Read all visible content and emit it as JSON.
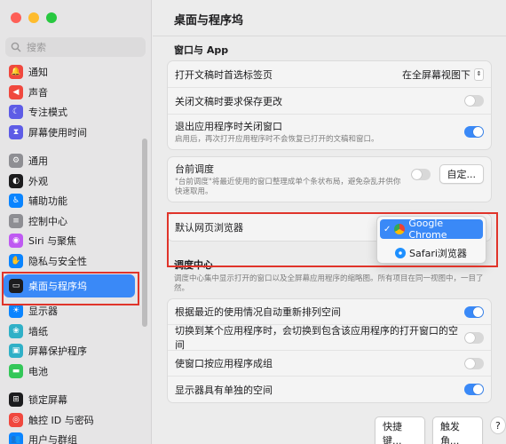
{
  "window": {
    "title": "桌面与程序坞"
  },
  "search": {
    "placeholder": "搜索"
  },
  "sidebar": {
    "items": [
      {
        "label": "通知",
        "icon": "bell-icon",
        "color": "#f0483e",
        "glyph": "🔔"
      },
      {
        "label": "声音",
        "icon": "speaker-icon",
        "color": "#f0483e",
        "glyph": "◀"
      },
      {
        "label": "专注模式",
        "icon": "moon-icon",
        "color": "#5e5ce6",
        "glyph": "☾"
      },
      {
        "label": "屏幕使用时间",
        "icon": "hourglass-icon",
        "color": "#5e5ce6",
        "glyph": "⧗"
      },
      {
        "label": "通用",
        "icon": "gear-icon",
        "color": "#8e8e93",
        "glyph": "⚙"
      },
      {
        "label": "外观",
        "icon": "appearance-icon",
        "color": "#1c1c1e",
        "glyph": "◐"
      },
      {
        "label": "辅助功能",
        "icon": "accessibility-icon",
        "color": "#0a84ff",
        "glyph": "♿"
      },
      {
        "label": "控制中心",
        "icon": "control-center-icon",
        "color": "#8e8e93",
        "glyph": "≡"
      },
      {
        "label": "Siri 与聚焦",
        "icon": "siri-icon",
        "color": "#bf5af2",
        "glyph": "◉"
      },
      {
        "label": "隐私与安全性",
        "icon": "hand-icon",
        "color": "#0a84ff",
        "glyph": "✋"
      },
      {
        "label": "桌面与程序坞",
        "icon": "dock-icon",
        "color": "#1c1c1e",
        "glyph": "▭"
      },
      {
        "label": "显示器",
        "icon": "display-icon",
        "color": "#0a84ff",
        "glyph": "☀"
      },
      {
        "label": "墙纸",
        "icon": "wallpaper-icon",
        "color": "#30b0c7",
        "glyph": "❀"
      },
      {
        "label": "屏幕保护程序",
        "icon": "screensaver-icon",
        "color": "#30b0c7",
        "glyph": "▣"
      },
      {
        "label": "电池",
        "icon": "battery-icon",
        "color": "#34c759",
        "glyph": "▬"
      },
      {
        "label": "锁定屏幕",
        "icon": "lock-icon",
        "color": "#1c1c1e",
        "glyph": "⊞"
      },
      {
        "label": "触控 ID 与密码",
        "icon": "fingerprint-icon",
        "color": "#f0483e",
        "glyph": "◎"
      },
      {
        "label": "用户与群组",
        "icon": "users-icon",
        "color": "#0a84ff",
        "glyph": "👥"
      }
    ]
  },
  "main": {
    "section_windows": "窗口与 App",
    "prefer_tabs": {
      "label": "打开文稿时首选标签页",
      "value": "在全屏幕视图下"
    },
    "ask_save": {
      "label": "关闭文稿时要求保存更改",
      "on": false
    },
    "close_windows": {
      "label": "退出应用程序时关闭窗口",
      "sub": "启用后，再次打开应用程序时不会恢复已打开的文稿和窗口。",
      "on": true
    },
    "stage_manager": {
      "label": "台前调度",
      "sub": "\"台前调度\"将最近使用的窗口整理成单个条状布局，避免杂乱并供你快速取用。",
      "on": false,
      "button": "自定..."
    },
    "default_browser": {
      "label": "默认网页浏览器",
      "options": [
        {
          "label": "Google Chrome",
          "selected": true
        },
        {
          "label": "Safari浏览器",
          "selected": false
        }
      ]
    },
    "mission_control": {
      "heading": "调度中心",
      "sub": "调度中心集中显示打开的窗口以及全屏幕应用程序的缩略图。所有项目在同一视图中，一目了然。"
    },
    "auto_rearrange": {
      "label": "根据最近的使用情况自动重新排列空间",
      "on": true
    },
    "switch_space": {
      "label": "切换到某个应用程序时，会切换到包含该应用程序的打开窗口的空间",
      "on": false
    },
    "group_windows": {
      "label": "使窗口按应用程序成组",
      "on": false
    },
    "separate_spaces": {
      "label": "显示器具有单独的空间",
      "on": true
    },
    "shortcuts_button": "快捷键...",
    "hot_corners_button": "触发角...",
    "help_button": "?"
  }
}
